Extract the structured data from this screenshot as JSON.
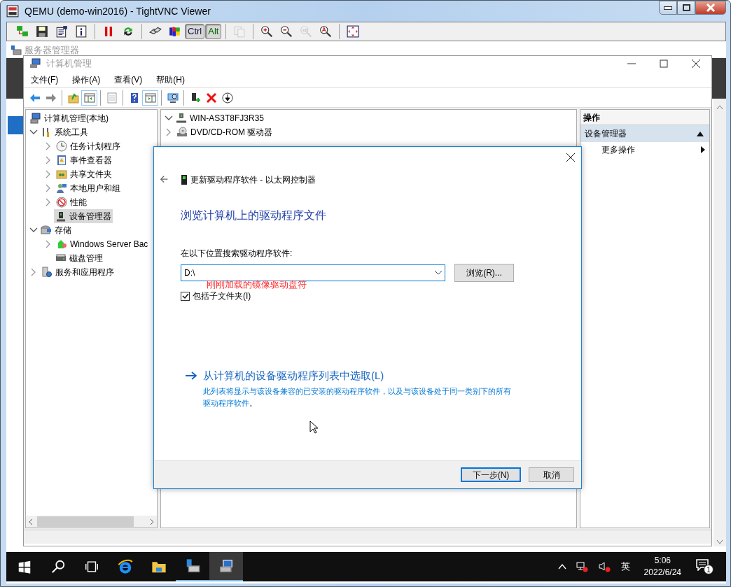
{
  "viewer": {
    "title": "QEMU (demo-win2016) - TightVNC Viewer",
    "toolbar": [
      {
        "kind": "options",
        "disabled": false
      },
      {
        "kind": "save",
        "disabled": false
      },
      {
        "kind": "properties",
        "disabled": false
      },
      {
        "kind": "info",
        "disabled": false
      },
      {
        "kind": "separator"
      },
      {
        "kind": "pause",
        "disabled": false
      },
      {
        "kind": "refresh",
        "disabled": false
      },
      {
        "kind": "separator"
      },
      {
        "kind": "ctrl_alt_del",
        "disabled": false
      },
      {
        "kind": "win_key",
        "disabled": false
      },
      {
        "kind": "key",
        "label": "Ctrl",
        "pressed": true
      },
      {
        "kind": "key",
        "label": "Alt",
        "pressed": true
      },
      {
        "kind": "separator"
      },
      {
        "kind": "copy",
        "disabled": true
      },
      {
        "kind": "separator"
      },
      {
        "kind": "zoom_in",
        "disabled": false
      },
      {
        "kind": "zoom_out",
        "disabled": false
      },
      {
        "kind": "zoom_100",
        "disabled": true
      },
      {
        "kind": "zoom_auto",
        "disabled": false
      },
      {
        "kind": "separator"
      },
      {
        "kind": "fullscreen",
        "disabled": false
      }
    ]
  },
  "background_window": {
    "title": "服务器管理器"
  },
  "computer_management": {
    "title": "计算机管理",
    "menu": [
      "文件(F)",
      "操作(A)",
      "查看(V)",
      "帮助(H)"
    ],
    "toolbar": [
      {
        "kind": "back",
        "pressed": false
      },
      {
        "kind": "forward",
        "pressed": false
      },
      {
        "kind": "separator"
      },
      {
        "kind": "up",
        "pressed": false
      },
      {
        "kind": "tree_toggle",
        "pressed": true
      },
      {
        "kind": "separator"
      },
      {
        "kind": "properties",
        "pressed": false
      },
      {
        "kind": "separator"
      },
      {
        "kind": "help",
        "pressed": false
      },
      {
        "kind": "action_toggle",
        "pressed": true
      },
      {
        "kind": "separator"
      },
      {
        "kind": "scan",
        "pressed": false
      },
      {
        "kind": "separator"
      },
      {
        "kind": "update_driver",
        "pressed": false
      },
      {
        "kind": "uninstall",
        "pressed": false
      },
      {
        "kind": "disable",
        "pressed": false
      }
    ],
    "tree": [
      {
        "label": "计算机管理(本地)",
        "selected": false,
        "children": [
          {
            "label": "系统工具",
            "expanded": true,
            "selected": false,
            "children": [
              {
                "label": "任务计划程序",
                "expanded": false,
                "selected": false
              },
              {
                "label": "事件查看器",
                "expanded": false,
                "selected": false
              },
              {
                "label": "共享文件夹",
                "expanded": false,
                "selected": false
              },
              {
                "label": "本地用户和组",
                "expanded": false,
                "selected": false
              },
              {
                "label": "性能",
                "expanded": false,
                "selected": false
              },
              {
                "label": "设备管理器",
                "selected": true
              }
            ]
          },
          {
            "label": "存储",
            "expanded": true,
            "selected": false,
            "children": [
              {
                "label": "Windows Server Bac",
                "expanded": false,
                "selected": false
              },
              {
                "label": "磁盘管理",
                "selected": false
              }
            ]
          },
          {
            "label": "服务和应用程序",
            "expanded": false,
            "selected": false
          }
        ]
      }
    ],
    "devices": [
      {
        "label": "WIN-AS3T8FJ3R35",
        "expanded": true,
        "children": [
          {
            "label": "DVD/CD-ROM 驱动器",
            "expanded": false
          }
        ]
      }
    ],
    "actions": {
      "header": "操作",
      "items": [
        {
          "label": "设备管理器",
          "kind": "section"
        },
        {
          "label": "更多操作",
          "kind": "submenu"
        }
      ]
    }
  },
  "dialog": {
    "title": "更新驱动程序软件 - 以太网控制器",
    "heading": "浏览计算机上的驱动程序文件",
    "path_label": "在以下位置搜索驱动程序软件:",
    "path": "D:\\",
    "browse": "浏览(R)...",
    "include_subfolders": {
      "label": "包括子文件夹(I)",
      "checked": true
    },
    "link": "从计算机的设备驱动程序列表中选取(L)",
    "link_description": "此列表将显示与该设备兼容的已安装的驱动程序软件，以及与该设备处于同一类别下的所有驱动程序软件。",
    "buttons": [
      {
        "label": "下一步(N)",
        "default": true
      },
      {
        "label": "取消",
        "default": false
      }
    ]
  },
  "annotation": "刚刚加载的镜像驱动盘符",
  "taskbar": {
    "apps": [
      {
        "kind": "start",
        "open": false,
        "active": false
      },
      {
        "kind": "search",
        "open": false,
        "active": false
      },
      {
        "kind": "task_view",
        "open": false,
        "active": false
      },
      {
        "kind": "browser",
        "open": false,
        "active": false
      },
      {
        "kind": "explorer",
        "open": false,
        "active": false
      },
      {
        "kind": "server_manager",
        "open": true,
        "active": false
      },
      {
        "kind": "computer_management",
        "open": true,
        "active": true
      }
    ],
    "ime": "英",
    "time": "5:06",
    "date": "2022/6/24",
    "notifications": "1"
  }
}
